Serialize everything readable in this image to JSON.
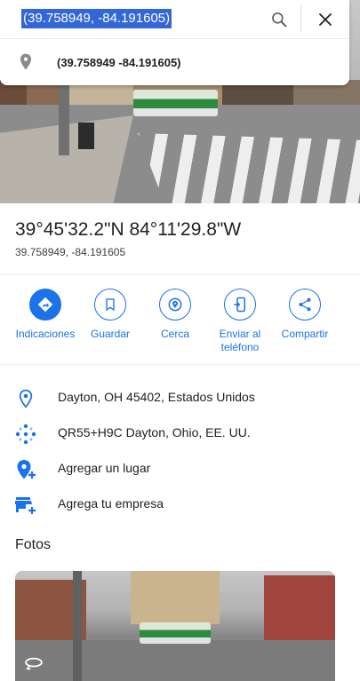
{
  "search": {
    "query": "(39.758949, -84.191605)",
    "suggestion": "(39.758949 -84.191605)"
  },
  "place": {
    "title": "39°45'32.2\"N 84°11'29.8\"W",
    "coords": "39.758949, -84.191605"
  },
  "actions": [
    {
      "label": "Indicaciones",
      "icon": "directions-icon"
    },
    {
      "label": "Guardar",
      "icon": "bookmark-icon"
    },
    {
      "label": "Cerca",
      "icon": "nearby-icon"
    },
    {
      "label": "Enviar al teléfono",
      "icon": "send-to-phone-icon"
    },
    {
      "label": "Compartir",
      "icon": "share-icon"
    }
  ],
  "info": [
    {
      "text": "Dayton, OH 45402, Estados Unidos",
      "icon": "location-pin-icon"
    },
    {
      "text": "QR55+H9C Dayton, Ohio, EE. UU.",
      "icon": "plus-code-icon"
    },
    {
      "text": "Agregar un lugar",
      "icon": "add-place-icon"
    },
    {
      "text": "Agrega tu empresa",
      "icon": "add-business-icon"
    }
  ],
  "photos": {
    "title": "Fotos"
  },
  "colors": {
    "accent": "#1a73e8",
    "selection": "#3367d6"
  }
}
